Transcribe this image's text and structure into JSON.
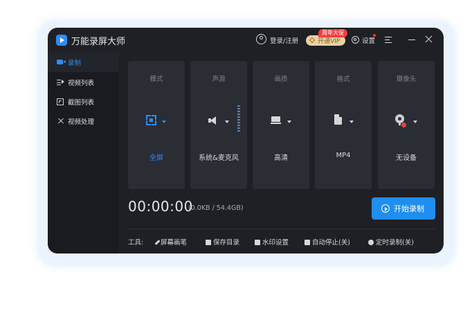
{
  "app": {
    "title": "万能录屏大师",
    "login": "登录/注册",
    "vip": "开通VIP",
    "promo": "周年大促",
    "settings": "设置"
  },
  "sidebar": {
    "items": [
      {
        "label": "录制",
        "icon": "camera-icon",
        "active": true
      },
      {
        "label": "视频列表",
        "icon": "video-list-icon"
      },
      {
        "label": "截图列表",
        "icon": "screenshot-list-icon"
      },
      {
        "label": "视频处理",
        "icon": "video-edit-icon"
      }
    ]
  },
  "options": [
    {
      "title": "模式",
      "value": "全屏",
      "icon": "fullscreen-icon"
    },
    {
      "title": "声源",
      "value": "系统&麦克风",
      "icon": "speaker-icon"
    },
    {
      "title": "画质",
      "value": "高清",
      "icon": "monitor-icon"
    },
    {
      "title": "格式",
      "value": "MP4",
      "icon": "file-icon"
    },
    {
      "title": "摄像头",
      "value": "无设备",
      "icon": "webcam-icon"
    }
  ],
  "status": {
    "timer": "00:00:00",
    "size": "(0.0KB / 54.4GB)"
  },
  "start_button": "开始录制",
  "tools": {
    "label": "工具:",
    "items": [
      "屏幕画笔",
      "保存目录",
      "水印设置",
      "自动停止(关)",
      "定时录制(关)"
    ]
  },
  "colors": {
    "accent": "#2f8cf7",
    "background": "#1f2025",
    "card": "#2b2d35",
    "promo": "#f13f3f"
  }
}
